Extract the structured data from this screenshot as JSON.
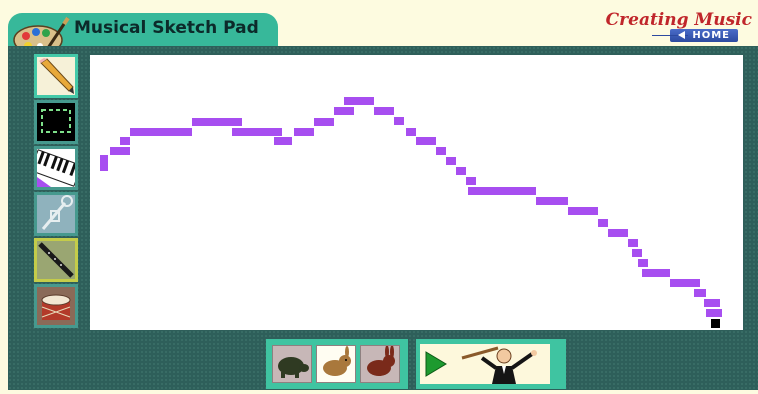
{
  "app": {
    "title": "Musical Sketch Pad",
    "brand": "Creating Music",
    "home_label": "HOME"
  },
  "colors": {
    "note": "#a74ef0",
    "frame": "#2e5f5a",
    "accent": "#3fc4a1",
    "brand": "#c0262b"
  },
  "tools": [
    {
      "name": "pencil-tool",
      "icon": "pencil-icon",
      "selected": true
    },
    {
      "name": "select-tool",
      "icon": "dashed-selection-icon",
      "selected": false
    },
    {
      "name": "piano-instrument",
      "icon": "piano-keys-icon",
      "selected": false
    },
    {
      "name": "trumpet-instrument",
      "icon": "trumpet-icon",
      "selected": false
    },
    {
      "name": "clarinet-instrument",
      "icon": "clarinet-icon",
      "selected": false
    },
    {
      "name": "drum-instrument",
      "icon": "drum-icon",
      "selected": false
    }
  ],
  "tempo": {
    "options": [
      "slow",
      "medium",
      "fast"
    ],
    "icons": [
      "turtle-icon",
      "rabbit-icon",
      "hare-icon"
    ],
    "selected": "medium"
  },
  "playback": {
    "play_icon": "play-triangle-icon",
    "conductor_icon": "conductor-icon"
  }
}
